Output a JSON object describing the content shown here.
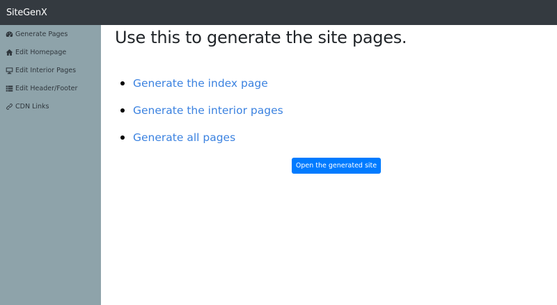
{
  "navbar": {
    "brand": "SiteGenX"
  },
  "sidebar": {
    "items": [
      {
        "label": "Generate Pages",
        "icon": "dashboard-icon"
      },
      {
        "label": "Edit Homepage",
        "icon": "home-icon"
      },
      {
        "label": "Edit Interior Pages",
        "icon": "desktop-icon"
      },
      {
        "label": "Edit Header/Footer",
        "icon": "list-icon"
      },
      {
        "label": "CDN Links",
        "icon": "link-icon"
      }
    ]
  },
  "main": {
    "title": "Use this to generate the site pages.",
    "links": [
      {
        "label": "Generate the index page"
      },
      {
        "label": "Generate the interior pages"
      },
      {
        "label": "Generate all pages"
      }
    ],
    "open_button": "Open the generated site"
  },
  "colors": {
    "navbar_bg": "#343a40",
    "sidebar_bg": "#8ea3aa",
    "link": "#3b82e0",
    "primary_button": "#007bff"
  }
}
